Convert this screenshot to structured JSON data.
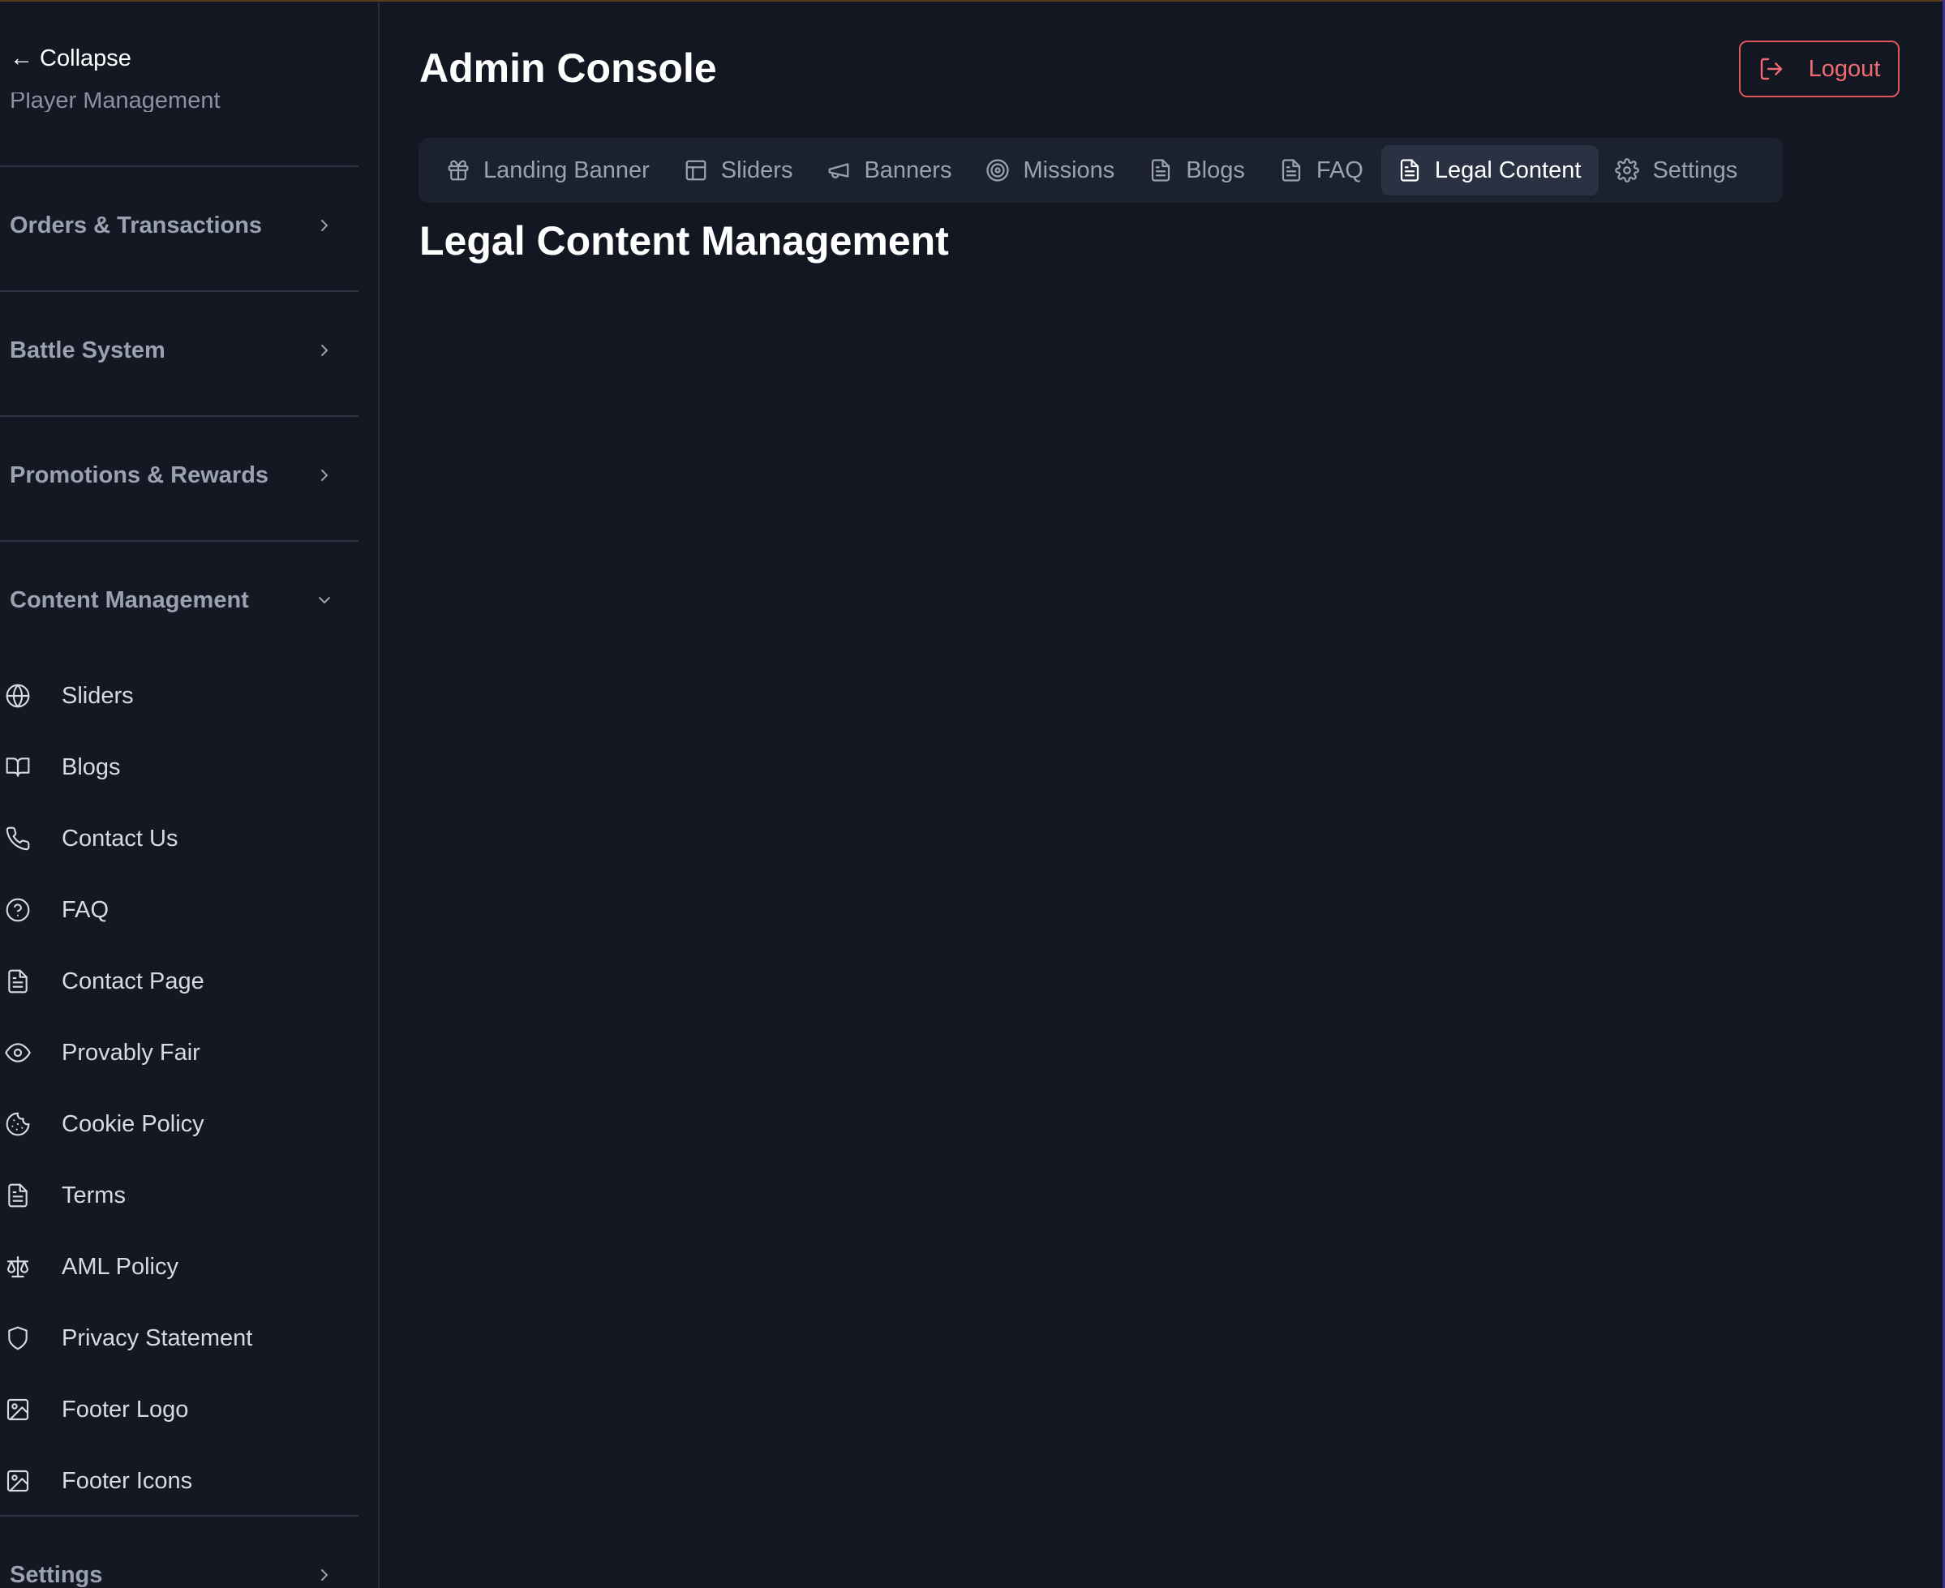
{
  "app": {
    "title": "Admin Console",
    "logout_label": "Logout"
  },
  "sidebar": {
    "collapse_label": "← Collapse",
    "clipped_label": "Player Management",
    "sections": [
      {
        "label": "Orders & Transactions",
        "icon": "chevron-right-icon"
      },
      {
        "label": "Battle System",
        "icon": "chevron-right-icon"
      },
      {
        "label": "Promotions & Rewards",
        "icon": "chevron-right-icon"
      },
      {
        "label": "Content Management",
        "icon": "chevron-down-icon"
      },
      {
        "label": "Settings",
        "icon": "chevron-right-icon"
      }
    ],
    "items": [
      {
        "label": "Sliders",
        "icon": "globe-icon"
      },
      {
        "label": "Blogs",
        "icon": "book-icon"
      },
      {
        "label": "Contact Us",
        "icon": "phone-icon"
      },
      {
        "label": "FAQ",
        "icon": "help-circle-icon"
      },
      {
        "label": "Contact Page",
        "icon": "file-text-icon"
      },
      {
        "label": "Provably Fair",
        "icon": "eye-icon"
      },
      {
        "label": "Cookie Policy",
        "icon": "cookie-icon"
      },
      {
        "label": "Terms",
        "icon": "file-text-icon"
      },
      {
        "label": "AML Policy",
        "icon": "scale-icon"
      },
      {
        "label": "Privacy Statement",
        "icon": "shield-icon"
      },
      {
        "label": "Footer Logo",
        "icon": "image-icon"
      },
      {
        "label": "Footer Icons",
        "icon": "image-icon"
      }
    ]
  },
  "tabs": [
    {
      "label": "Landing Banner",
      "icon": "gift-icon"
    },
    {
      "label": "Sliders",
      "icon": "layout-icon"
    },
    {
      "label": "Banners",
      "icon": "megaphone-icon"
    },
    {
      "label": "Missions",
      "icon": "target-icon"
    },
    {
      "label": "Blogs",
      "icon": "file-text-icon"
    },
    {
      "label": "FAQ",
      "icon": "file-text-icon"
    },
    {
      "label": "Legal Content",
      "icon": "file-text-icon",
      "active": true
    },
    {
      "label": "Settings",
      "icon": "settings-icon"
    }
  ],
  "main": {
    "section_title": "Legal Content Management"
  },
  "colors": {
    "background": "#131722",
    "accent_danger": "#e0545c",
    "tab_active_bg": "#2a3142"
  }
}
